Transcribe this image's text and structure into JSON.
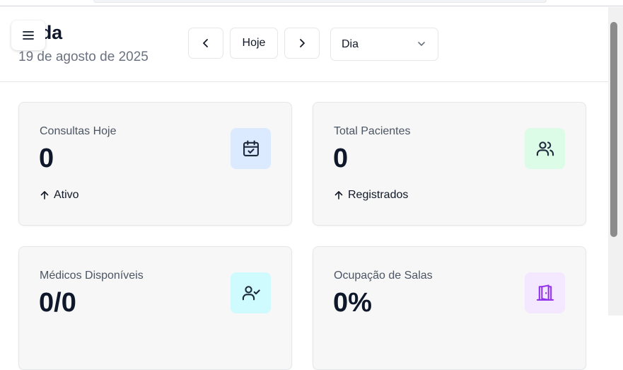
{
  "header": {
    "title": "enda",
    "date": "19 de agosto de 2025",
    "nav": {
      "today_label": "Hoje"
    },
    "view_select": {
      "selected": "Dia"
    }
  },
  "colors": {
    "blue_bg": "#dbeafe",
    "green_bg": "#dcfce7",
    "cyan_bg": "#cffafe",
    "purple_bg": "#f3e8ff",
    "purple_icon": "#9333ea"
  },
  "cards": [
    {
      "label": "Consultas Hoje",
      "value": "0",
      "trend": "Ativo",
      "icon": "calendar-check-icon"
    },
    {
      "label": "Total Pacientes",
      "value": "0",
      "trend": "Registrados",
      "icon": "users-icon"
    },
    {
      "label": "Médicos Disponíveis",
      "value": "0/0",
      "trend": "",
      "icon": "user-check-icon"
    },
    {
      "label": "Ocupação de Salas",
      "value": "0%",
      "trend": "",
      "icon": "door-open-icon"
    }
  ]
}
